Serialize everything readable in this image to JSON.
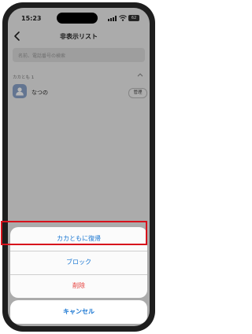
{
  "status_bar": {
    "time": "15:23",
    "battery": "62"
  },
  "header": {
    "title": "非表示リスト"
  },
  "search": {
    "placeholder": "名前、電話番号の検索"
  },
  "section": {
    "label": "カカとも 1"
  },
  "contact": {
    "name": "なつの",
    "manage_label": "管理"
  },
  "action_sheet": {
    "restore_label": "カカともに復帰",
    "block_label": "ブロック",
    "delete_label": "削除",
    "cancel_label": "キャンセル"
  },
  "colors": {
    "accent": "#1976d2",
    "destructive": "#e53935",
    "highlight": "#d7121c"
  },
  "icons": [
    "back-chevron-icon",
    "wifi-icon",
    "signal-icon",
    "battery-icon",
    "collapse-chevron-icon",
    "person-icon"
  ]
}
